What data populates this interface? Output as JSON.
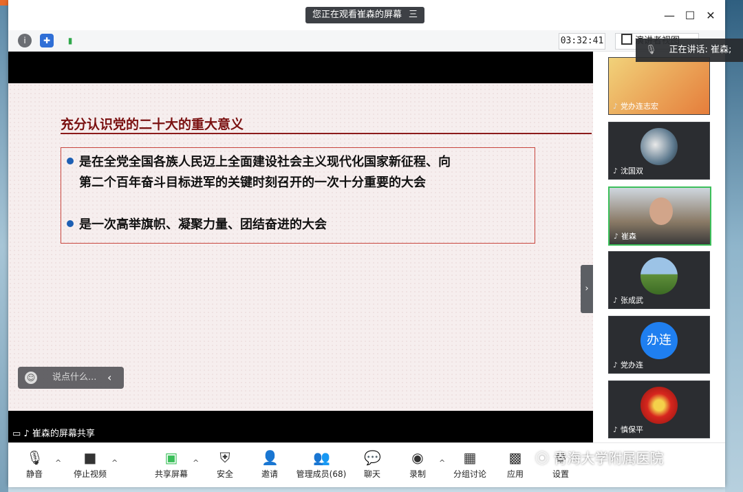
{
  "window": {
    "watch_banner": "您正在观看崔森的屏幕",
    "banner_icon": "三",
    "minimize": "—",
    "maximize": "☐",
    "close": "✕"
  },
  "infobar": {
    "timer": "03:32:41",
    "view_label": "演讲者视图"
  },
  "speaking": {
    "label": "正在讲话: 崔森;"
  },
  "slide": {
    "title": "充分认识党的二十大的重大意义",
    "bullet1_line1": "是在全党全国各族人民迈上全面建设社会主义现代化国家新征程、向",
    "bullet1_line2": "第二个百年奋斗目标进军的关键时刻召开的一次十分重要的大会",
    "bullet2": "是一次高举旗帜、凝聚力量、团结奋进的大会"
  },
  "chat_pill": {
    "placeholder": "说点什么..."
  },
  "share_label": "崔森的屏幕共享",
  "participants": [
    {
      "name": "党办连志宏"
    },
    {
      "name": "沈国双"
    },
    {
      "name": "崔森"
    },
    {
      "name": "张成武"
    },
    {
      "name": "党办连",
      "avatar_text": "办连"
    },
    {
      "name": "慎保平"
    }
  ],
  "toolbar": {
    "mute": "静音",
    "stop_video": "停止视频",
    "share_screen": "共享屏幕",
    "security": "安全",
    "invite": "邀请",
    "manage": "管理成员(68)",
    "chat": "聊天",
    "record": "录制",
    "breakout": "分组讨论",
    "apps": "应用",
    "settings": "设置"
  },
  "watermark": "青海大学附属医院",
  "colors": {
    "accent_green": "#3bbf5a",
    "slide_title": "#7a1010",
    "bullet_blue": "#1d5fb3"
  }
}
